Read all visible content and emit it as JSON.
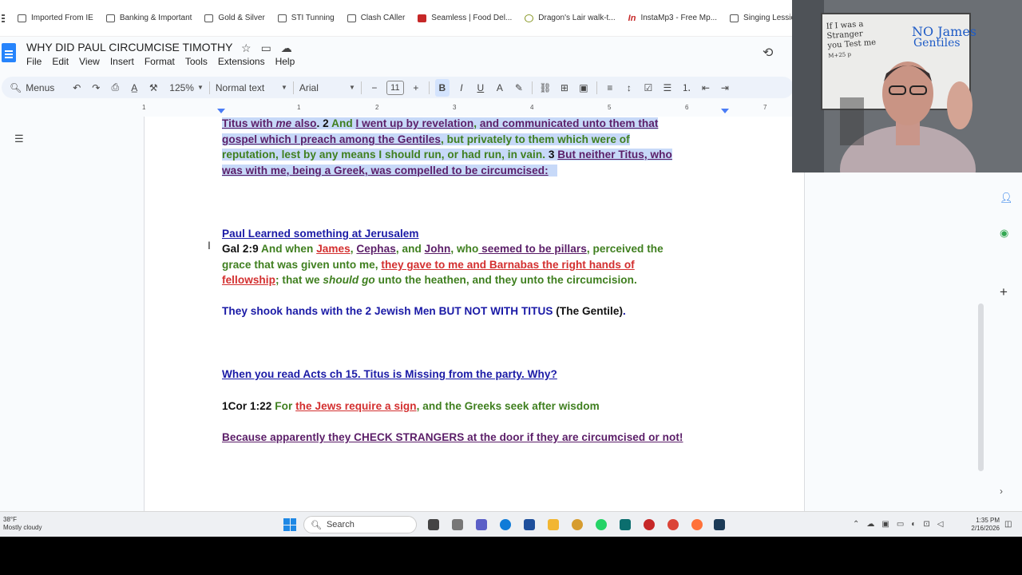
{
  "bookmarks": [
    {
      "label": "Imported From IE",
      "icon": "folder-icon"
    },
    {
      "label": "Banking & Important",
      "icon": "folder-icon"
    },
    {
      "label": "Gold & Silver",
      "icon": "folder-icon"
    },
    {
      "label": "STI Tunning",
      "icon": "folder-icon"
    },
    {
      "label": "Clash CAller",
      "icon": "folder-icon"
    },
    {
      "label": "Seamless | Food Del...",
      "icon": "seamless-icon"
    },
    {
      "label": "Dragon's Lair walk-t...",
      "icon": "dragon-icon"
    },
    {
      "label": "InstaMp3 - Free Mp...",
      "icon": "instamp3-icon"
    },
    {
      "label": "Singing Lessions",
      "icon": "folder-icon"
    }
  ],
  "doc": {
    "title": "WHY DID PAUL CIRCUMCISE TIMOTHY",
    "menu": [
      "File",
      "Edit",
      "View",
      "Insert",
      "Format",
      "Tools",
      "Extensions",
      "Help"
    ]
  },
  "toolbar": {
    "menus_label": "Menus",
    "zoom": "125%",
    "style": "Normal text",
    "font": "Arial",
    "font_size": "11",
    "minus": "−",
    "plus": "+"
  },
  "ruler": [
    "1",
    "1",
    "2",
    "3",
    "4",
    "5",
    "6",
    "7"
  ],
  "content": {
    "l1": {
      "a": "Titus with ",
      "b": "me",
      "c": " also",
      "d": ". 2 ",
      "e": "And ",
      "f": "I went up by revelation",
      "g": ", ",
      "h": "and communicated unto them that"
    },
    "l2": {
      "a": "gospel which I preach among the Gentiles",
      "b": ", but privately to them which were of"
    },
    "l3": {
      "a": "reputation, lest by any means I should run, or had run, in vain. ",
      "b": "3 ",
      "c": "But neither Titus, who"
    },
    "l4": {
      "a": "was with me, being a Greek, was compelled to be circumcised:"
    },
    "heading1": "Paul Learned something at Jerusalem",
    "gal": {
      "ref": "Gal 2:9",
      "a": " And when ",
      "james": "James",
      "c1": ", ",
      "cephas": "Cephas",
      "c2": ", and ",
      "john": "John",
      "c3": ", who",
      "pillars": " seemed to be pillars",
      "c4": ", perceived the"
    },
    "gal2": {
      "a": "grace that was given unto me, ",
      "b": "they gave to me and Barnabas the right hands of"
    },
    "gal3": {
      "a": "fellowship",
      "b": "; that we ",
      "c": "should go",
      "d": " unto the heathen, and they unto the circumcision."
    },
    "shook": {
      "a": "They shook hands with the 2 Jewish Men BUT NOT WITH TITUS",
      "b": " (The Gentile)",
      "c": "."
    },
    "acts": "When you read Acts ch 15. Titus is Missing from the party. Why?",
    "cor": {
      "ref": "1Cor 1:22",
      "a": " For ",
      "b": "the Jews require a sign",
      "c": ", and the Greeks seek after wisdom"
    },
    "because": "Because apparently they CHECK STRANGERS at the door if they are circumcised or not!"
  },
  "webcam": {
    "whiteboard_lines": [
      "If I was a",
      "Stranger",
      "you Test me",
      "M+25 p"
    ],
    "whiteboard_no": "NO James",
    "whiteboard_gentiles": "Gentiles"
  },
  "taskbar": {
    "temp": "38°F",
    "weather": "Mostly cloudy",
    "search": "Search",
    "time": "1:35 PM",
    "date": "2/16/2026"
  },
  "colors": {
    "accent": "#1a73e8",
    "selection": "#c7d9f8"
  }
}
